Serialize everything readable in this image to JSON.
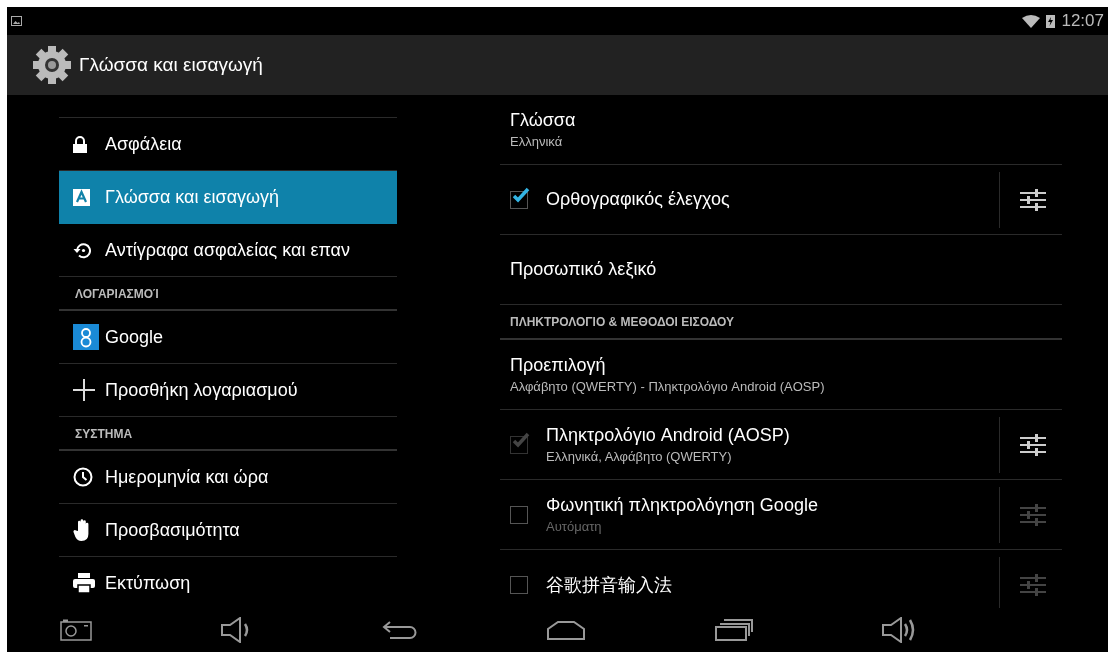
{
  "status_bar": {
    "time": "12:07"
  },
  "action_bar": {
    "title": "Γλώσσα και εισαγωγή"
  },
  "sidebar": {
    "items": [
      {
        "kind": "item",
        "label": "Ασφάλεια",
        "selected": false
      },
      {
        "kind": "item",
        "label": "Γλώσσα και εισαγωγή",
        "selected": true
      },
      {
        "kind": "item",
        "label": "Αντίγραφα ασφαλείας και επαν",
        "selected": false
      },
      {
        "kind": "header",
        "label": "ΛΟΓΑΡΙΑΣΜΟΊ"
      },
      {
        "kind": "item",
        "label": "Google",
        "selected": false
      },
      {
        "kind": "item",
        "label": "Προσθήκη λογαριασμού",
        "selected": false
      },
      {
        "kind": "header",
        "label": "ΣΥΣΤΗΜΑ"
      },
      {
        "kind": "item",
        "label": "Ημερομηνία και ώρα",
        "selected": false
      },
      {
        "kind": "item",
        "label": "Προσβασιμότητα",
        "selected": false
      },
      {
        "kind": "item",
        "label": "Εκτύπωση",
        "selected": false
      }
    ]
  },
  "settings": [
    {
      "kind": "plain",
      "title": "Γλώσσα",
      "subtitle": "Ελληνικά"
    },
    {
      "kind": "check",
      "title": "Ορθογραφικός έλεγχος",
      "checked": true,
      "disabled": false,
      "settings_enabled": true
    },
    {
      "kind": "plain",
      "title": "Προσωπικό λεξικό"
    },
    {
      "kind": "header",
      "title": "ΠΛΗΚΤΡΟΛΟΓΙΟ & ΜΕΘΟΔΟΙ ΕΙΣΟΔΟΥ"
    },
    {
      "kind": "plain",
      "title": "Προεπιλογή",
      "subtitle": "Αλφάβητο (QWERTY) - Πληκτρολόγιο Android (AOSP)"
    },
    {
      "kind": "check",
      "title": "Πληκτρολόγιο Android (AOSP)",
      "subtitle": "Ελληνικά, Αλφάβητο (QWERTY)",
      "checked": true,
      "disabled": true,
      "settings_enabled": true
    },
    {
      "kind": "check",
      "title": "Φωνητική πληκτρολόγηση Google",
      "subtitle": "Αυτόματη",
      "checked": false,
      "disabled": false,
      "settings_enabled": false
    },
    {
      "kind": "check",
      "title": "谷歌拼音输入法",
      "checked": false,
      "disabled": false,
      "settings_enabled": false
    }
  ]
}
